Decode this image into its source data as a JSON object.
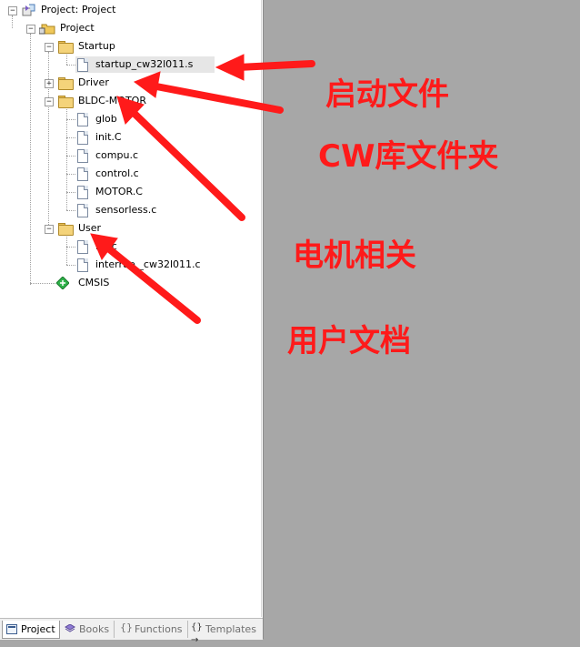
{
  "tree": {
    "root_label": "Project: Project",
    "project_label": "Project",
    "startup": {
      "label": "Startup",
      "files": [
        "startup_cw32l011.s"
      ]
    },
    "driver": {
      "label": "Driver"
    },
    "bldc": {
      "label": "BLDC-MOTOR",
      "files": [
        "glob",
        "init.C",
        "compu.c",
        "control.c",
        "MOTOR.C",
        "sensorless.c"
      ]
    },
    "user": {
      "label": "User",
      "files": [
        "m      .c",
        "interrup    _cw32l011.c"
      ]
    },
    "cmsis": {
      "label": "CMSIS"
    }
  },
  "bottom_tabs": [
    "Project",
    "Books",
    "Functions",
    "Templates"
  ],
  "annotations": {
    "startup_file": "启动文件",
    "cw_lib": "CW库文件夹",
    "motor": "电机相关",
    "user_docs": "用户文档"
  },
  "colors": {
    "annotation": "#ff1a1a",
    "background": "#a7a7a7"
  }
}
